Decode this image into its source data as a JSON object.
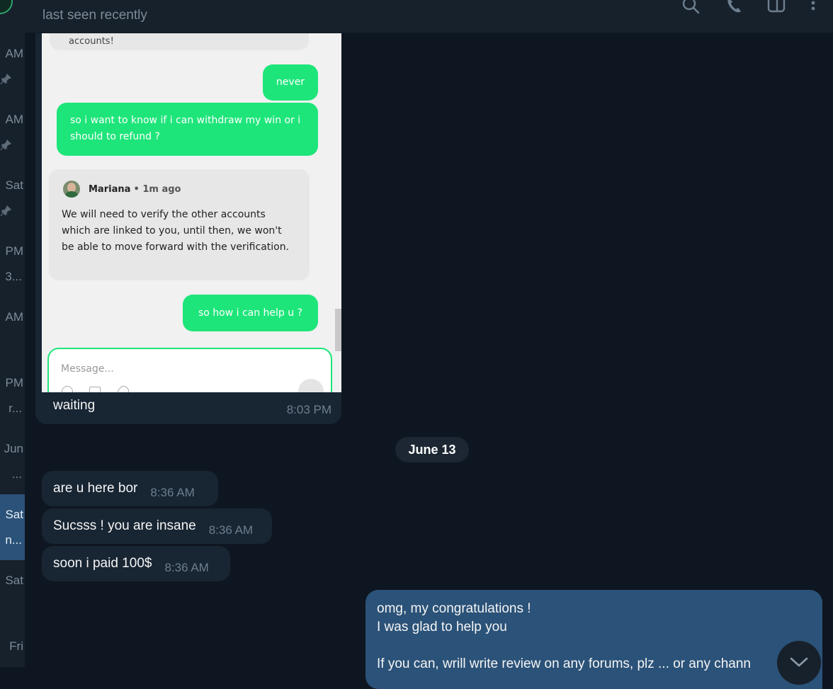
{
  "sidebar": {
    "items": [
      {
        "time": "AM",
        "sub": "",
        "pinned": true
      },
      {
        "time": "AM",
        "sub": "",
        "pinned": true
      },
      {
        "time": "Sat",
        "sub": "",
        "pinned": true
      },
      {
        "time": "PM",
        "sub": "3..."
      },
      {
        "time": "AM",
        "sub": ""
      },
      {
        "time": "PM",
        "sub": "r..."
      },
      {
        "time": "Jun",
        "sub": "..."
      },
      {
        "time": "Sat",
        "sub": "n...",
        "active": true
      },
      {
        "time": "Sat",
        "sub": ""
      },
      {
        "time": "Fri",
        "sub": ""
      }
    ]
  },
  "header": {
    "status": "last seen recently",
    "icons": [
      "search-icon",
      "phone-icon",
      "sidebar-toggle-icon",
      "more-vertical-icon"
    ]
  },
  "media_message": {
    "screenshot": {
      "partial_top": "accounts!",
      "msg_never": "never",
      "msg_withdraw": "so i want to know if i can withdraw my win or i should to refund ?",
      "agent_name": "Mariana",
      "agent_time": "• 1m ago",
      "agent_text": "We will need to verify the other accounts which are linked to you, until then, we won't be able to move forward with the verification.",
      "msg_help": "so how i can help u ?",
      "input_placeholder": "Message..."
    },
    "caption": "waiting",
    "time": "8:03 PM"
  },
  "date_divider": "June 13",
  "incoming": [
    {
      "text": "are u here bor",
      "time": "8:36 AM"
    },
    {
      "text": "Sucsss ! you are insane",
      "time": "8:36 AM"
    },
    {
      "text": "soon i paid 100$",
      "time": "8:36 AM"
    }
  ],
  "outgoing": {
    "line1": "omg, my congratulations !",
    "line2": "I was glad to help you",
    "line3": "",
    "line4": "If you can, wrill write review on any forums, plz ... or any chann"
  },
  "colors": {
    "background": "#0e1621",
    "panel": "#17212b",
    "incoming_bubble": "#182533",
    "outgoing_bubble": "#2b5278",
    "active_chat": "#2b5278",
    "green_bubble": "#1ee57a"
  }
}
